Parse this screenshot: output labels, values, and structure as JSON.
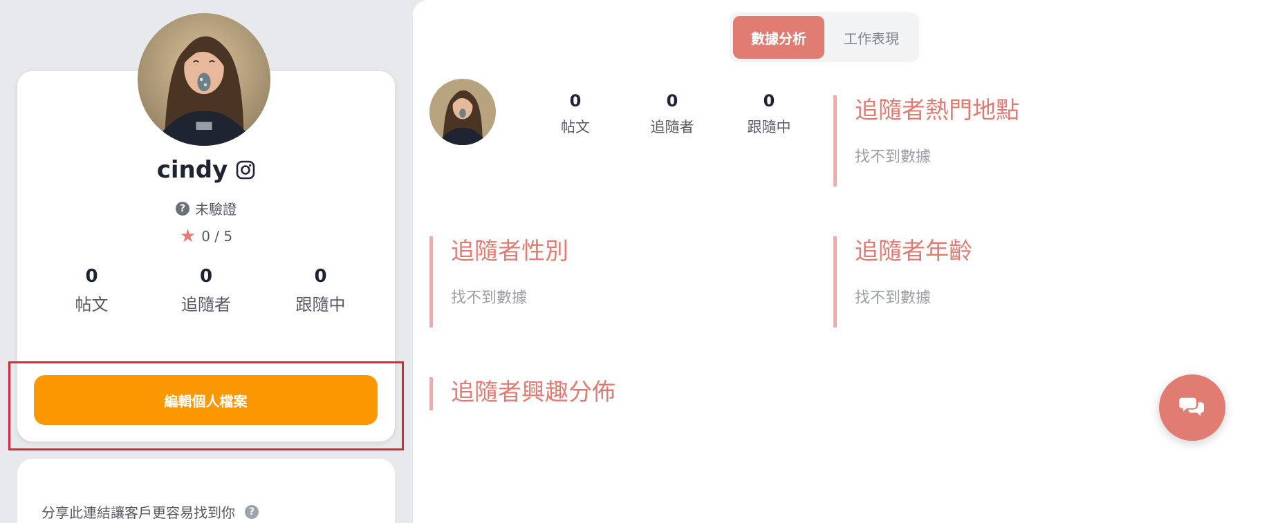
{
  "profile": {
    "username": "cindy",
    "verification_status": "未驗證",
    "rating": "0 / 5",
    "stats": [
      {
        "value": "0",
        "label": "帖文"
      },
      {
        "value": "0",
        "label": "追隨者"
      },
      {
        "value": "0",
        "label": "跟隨中"
      }
    ],
    "edit_button_label": "編輯個人檔案",
    "platform_icon": "instagram-icon"
  },
  "share": {
    "text": "分享此連結讓客戶更容易找到你"
  },
  "tabs": [
    {
      "label": "數據分析",
      "active": true
    },
    {
      "label": "工作表現",
      "active": false
    }
  ],
  "analytics": {
    "stats": [
      {
        "value": "0",
        "label": "帖文"
      },
      {
        "value": "0",
        "label": "追隨者"
      },
      {
        "value": "0",
        "label": "跟隨中"
      }
    ],
    "sections": {
      "location": {
        "title": "追隨者熱門地點",
        "empty": "找不到數據"
      },
      "gender": {
        "title": "追隨者性別",
        "empty": "找不到數據"
      },
      "age": {
        "title": "追隨者年齡",
        "empty": "找不到數據"
      },
      "interest": {
        "title": "追隨者興趣分佈"
      }
    }
  },
  "colors": {
    "accent": "#e07c72",
    "edit_button": "#fb9700",
    "highlight": "#d72a34",
    "section_border": "#f4a8a8"
  },
  "icons": {
    "question": "question-circle-icon",
    "star": "star-icon",
    "chat": "chat-bubbles-icon"
  }
}
